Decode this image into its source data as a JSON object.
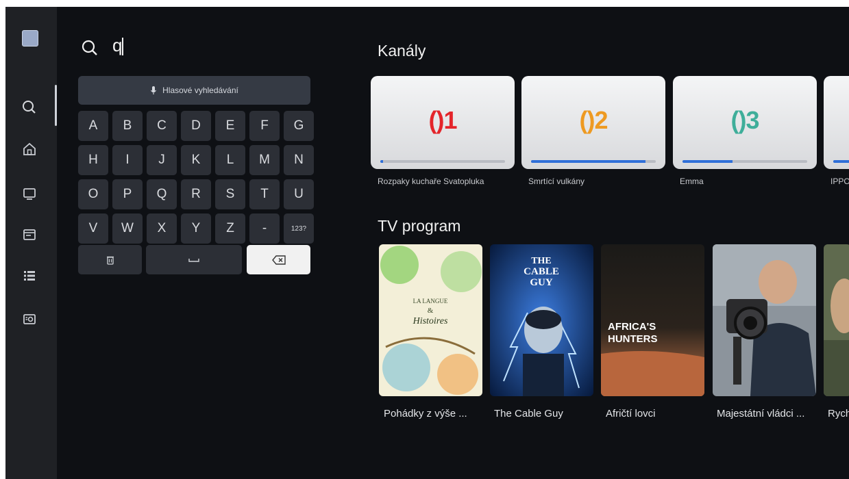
{
  "search": {
    "query": "q",
    "voice_label": "Hlasové vyhledávání"
  },
  "sidebar": {
    "items": [
      {
        "icon": "search-icon",
        "active": true
      },
      {
        "icon": "home-icon"
      },
      {
        "icon": "tv-icon"
      },
      {
        "icon": "guide-icon"
      },
      {
        "icon": "list-icon"
      },
      {
        "icon": "recordings-icon"
      }
    ]
  },
  "keyboard": {
    "rows": [
      [
        "A",
        "B",
        "C",
        "D",
        "E",
        "F",
        "G"
      ],
      [
        "H",
        "I",
        "J",
        "K",
        "L",
        "M",
        "N"
      ],
      [
        "O",
        "P",
        "Q",
        "R",
        "S",
        "T",
        "U"
      ],
      [
        "V",
        "W",
        "X",
        "Y",
        "Z",
        "-",
        "123?"
      ]
    ]
  },
  "channels": {
    "title": "Kanály",
    "items": [
      {
        "logo": "1",
        "color": "#e4252b",
        "progress": 0.02,
        "caption": "Rozpaky kuchaře Svatopluka"
      },
      {
        "logo": "2",
        "color": "#ee9a22",
        "progress": 0.92,
        "caption": "Smrtící vulkány"
      },
      {
        "logo": "3",
        "color": "#3fae9a",
        "progress": 0.4,
        "caption": "Emma"
      },
      {
        "logo": "",
        "color": "#2f6fd8",
        "progress": 0.5,
        "caption": "IPPO"
      }
    ]
  },
  "program": {
    "title": "TV program",
    "items": [
      {
        "caption": "Pohádky z výše ...",
        "poster_text": [
          "LA LANGUE",
          "&",
          "Histoires"
        ]
      },
      {
        "caption": "The Cable Guy",
        "poster_text": [
          "THE",
          "CABLE",
          "GUY"
        ]
      },
      {
        "caption": "Afričtí lovci",
        "poster_text": [
          "AFRICA'S",
          "HUNTERS"
        ]
      },
      {
        "caption": "Majestátní vládci ...",
        "poster_text": []
      },
      {
        "caption": "Rych",
        "poster_text": []
      }
    ]
  }
}
